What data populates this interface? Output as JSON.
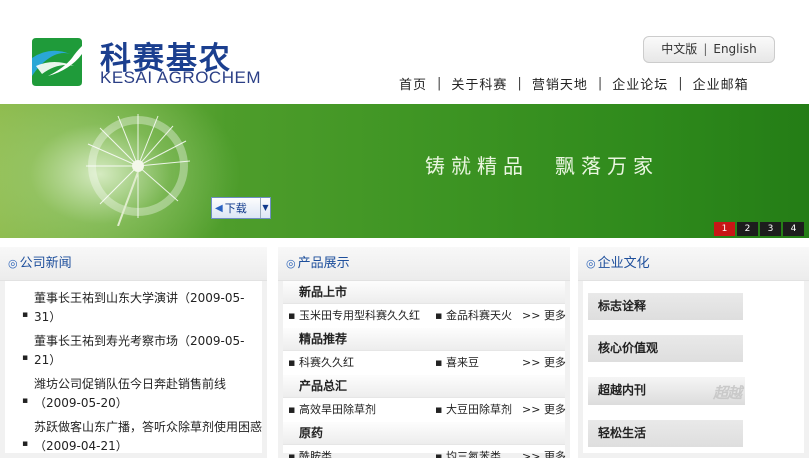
{
  "brand": {
    "name_cn": "科赛基农",
    "name_en": "KESAI AGROCHEM",
    "colors": {
      "primary": "#1b3f8f",
      "accent": "#2aa7d6",
      "green": "#3d9423"
    }
  },
  "lang": {
    "cn": "中文版",
    "sep": "|",
    "en": "English"
  },
  "nav": {
    "items": [
      {
        "label": "首页"
      },
      {
        "label": "关于科赛"
      },
      {
        "label": "营销天地"
      },
      {
        "label": "企业论坛"
      },
      {
        "label": "企业邮箱"
      }
    ],
    "sep": "|"
  },
  "banner": {
    "slogan": "铸就精品　飘落万家",
    "download_label": "下载",
    "pages": [
      "1",
      "2",
      "3",
      "4"
    ],
    "active_page": "1"
  },
  "news": {
    "title": "公司新闻",
    "icon": "circle-bullet-icon",
    "items": [
      {
        "text": "董事长王祐到山东大学演讲（2009-05-31）"
      },
      {
        "text": "董事长王祐到寿光考察市场（2009-05-21）"
      },
      {
        "text": "潍坊公司促销队伍今日奔赴销售前线（2009-05-20）"
      },
      {
        "text": "苏跃做客山东广播，答听众除草剂使用困惑（2009-04-21）"
      }
    ]
  },
  "products": {
    "title": "产品展示",
    "sections": [
      {
        "category": "新品上市",
        "a": "▪ 玉米田专用型科赛久久红",
        "b": "▪ 金品科赛天火",
        "more": "更多"
      },
      {
        "category": "精品推荐",
        "a": "▪ 科赛久久红",
        "b": "▪ 喜来豆",
        "more": "更多"
      },
      {
        "category": "产品总汇",
        "a": "▪ 高效旱田除草剂",
        "b": "▪ 大豆田除草剂",
        "more": "更多"
      },
      {
        "category": "原药",
        "a": "▪ 酰胺类",
        "b": "▪ 均三氮苯类",
        "more": "更多"
      }
    ],
    "more_prefix": ">>"
  },
  "culture": {
    "title": "企业文化",
    "items": [
      {
        "label": "标志诠释"
      },
      {
        "label": "核心价值观"
      },
      {
        "label": "超越内刊",
        "logo_text": "超越"
      },
      {
        "label": "轻松生活"
      }
    ]
  }
}
